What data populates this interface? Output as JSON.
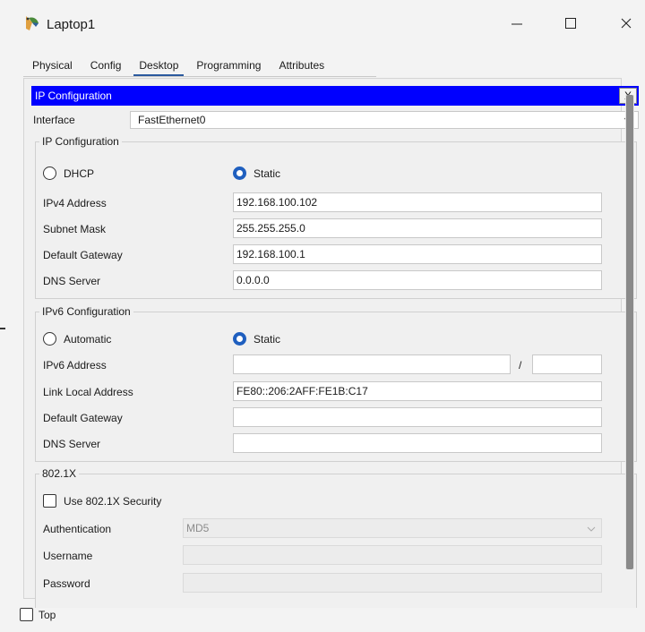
{
  "window": {
    "title": "Laptop1",
    "controls": {
      "minimize": "—",
      "maximize": "☐",
      "close": "✕"
    }
  },
  "tabs": [
    "Physical",
    "Config",
    "Desktop",
    "Programming",
    "Attributes"
  ],
  "active_tab": "Desktop",
  "panel": {
    "header": "IP Configuration",
    "close_label": "X",
    "interface_label": "Interface",
    "interface_value": "FastEthernet0"
  },
  "ipv4": {
    "group_label": "IP Configuration",
    "dhcp_label": "DHCP",
    "static_label": "Static",
    "selected": "Static",
    "fields": [
      {
        "label": "IPv4 Address",
        "value": "192.168.100.102"
      },
      {
        "label": "Subnet Mask",
        "value": "255.255.255.0"
      },
      {
        "label": "Default Gateway",
        "value": "192.168.100.1"
      },
      {
        "label": "DNS Server",
        "value": "0.0.0.0"
      }
    ]
  },
  "ipv6": {
    "group_label": "IPv6 Configuration",
    "automatic_label": "Automatic",
    "static_label": "Static",
    "selected": "Static",
    "address_label": "IPv6 Address",
    "address_value": "",
    "prefix_separator": "/",
    "prefix_value": "",
    "fields": [
      {
        "label": "Link Local Address",
        "value": "FE80::206:2AFF:FE1B:C17"
      },
      {
        "label": "Default Gateway",
        "value": ""
      },
      {
        "label": "DNS Server",
        "value": ""
      }
    ]
  },
  "dot1x": {
    "group_label": "802.1X",
    "use_security_label": "Use 802.1X Security",
    "use_security_checked": false,
    "authentication_label": "Authentication",
    "authentication_value": "MD5",
    "username_label": "Username",
    "username_value": "",
    "password_label": "Password",
    "password_value": ""
  },
  "bottom": {
    "top_label": "Top",
    "top_checked": false
  },
  "colors": {
    "header_bg": "#0000ff",
    "radio_on": "#1f5fbf",
    "tab_underline": "#2b5a9e"
  }
}
